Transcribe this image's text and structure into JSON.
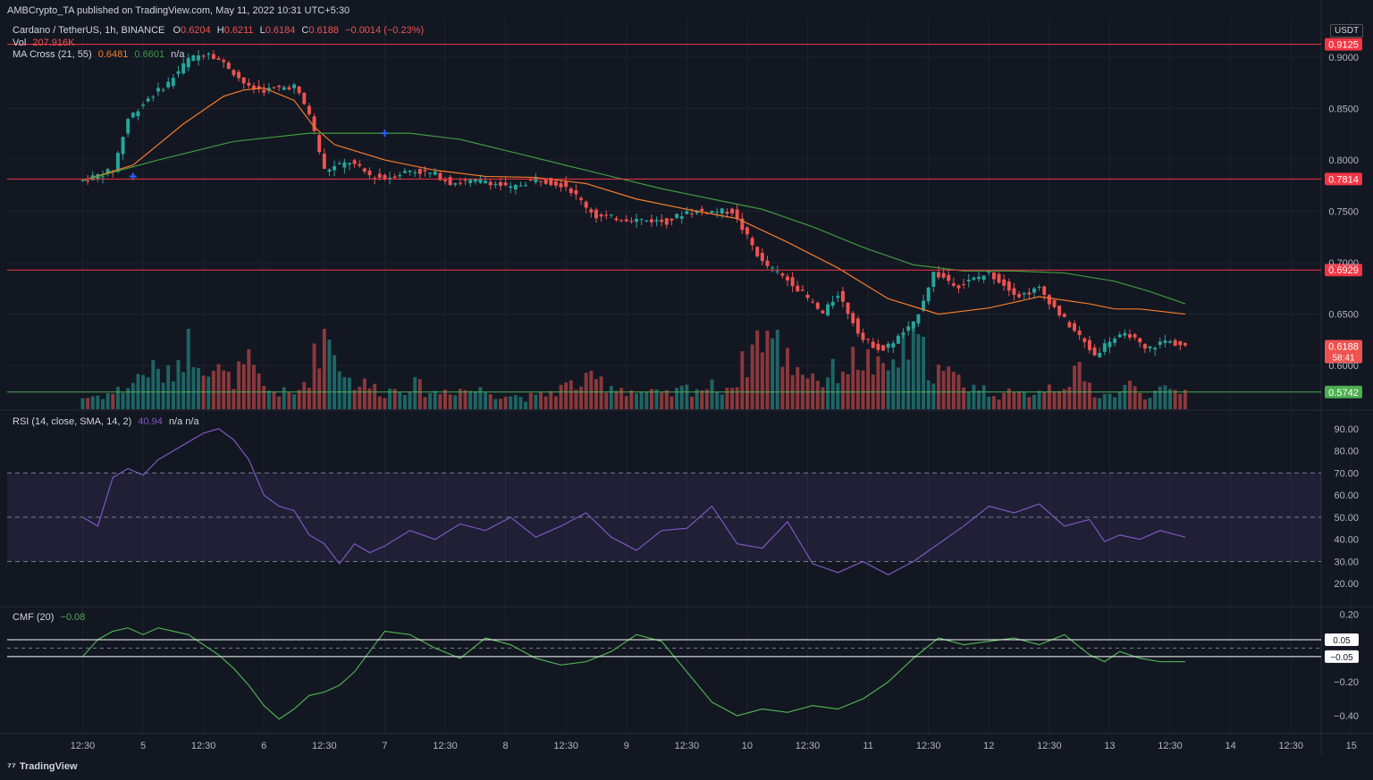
{
  "publisher": "AMBCrypto_TA published on TradingView.com, May 11, 2022 10:31 UTC+5:30",
  "symbol": {
    "name": "Cardano / TetherUS, 1h, BINANCE",
    "open_label": "O",
    "open": "0.6204",
    "high_label": "H",
    "high": "0.6211",
    "low_label": "L",
    "low": "0.6184",
    "close_label": "C",
    "close": "0.6188",
    "change": "−0.0014 (−0.23%)"
  },
  "vol": {
    "label": "Vol",
    "value": "207.916K"
  },
  "ma_cross": {
    "label": "MA Cross (21, 55)",
    "fast": "0.6481",
    "slow": "0.6601",
    "extra": "n/a"
  },
  "rsi_header": {
    "label": "RSI (14, close, SMA, 14, 2)",
    "value": "40.94",
    "extra": "n/a n/a"
  },
  "cmf_header": {
    "label": "CMF (20)",
    "value": "−0.08"
  },
  "currency": "USDT",
  "watermark": "TradingView",
  "colors": {
    "background": "#131722",
    "up": "#26a69a",
    "down": "#ef5350",
    "ma_fast": "#f57c2a",
    "ma_slow": "#3e9a3e",
    "rsi": "#7e57c2",
    "cmf": "#4caf50",
    "resistance": "#f23645",
    "support": "#4caf50",
    "marker": "#2962ff"
  },
  "price_levels": [
    {
      "value": 0.9125,
      "label": "0.9125",
      "kind": "resistance"
    },
    {
      "value": 0.7814,
      "label": "0.7814",
      "kind": "resistance"
    },
    {
      "value": 0.6929,
      "label": "0.6929",
      "kind": "resistance"
    },
    {
      "value": 0.5742,
      "label": "0.5742",
      "kind": "support"
    }
  ],
  "last_price": {
    "value": 0.6188,
    "label": "0.6188",
    "countdown": "58:41"
  },
  "cmf_levels": [
    {
      "value": 0.05,
      "label": "0.05"
    },
    {
      "value": -0.05,
      "label": "−0.05"
    }
  ],
  "chart_data": [
    {
      "type": "line",
      "pane": "price",
      "ylim": [
        0.5575,
        0.9365
      ],
      "yticks": [
        "0.9000",
        "0.8500",
        "0.8000",
        "0.7500",
        "0.7000",
        "0.6500",
        "0.6000"
      ],
      "ytick_values": [
        0.9,
        0.85,
        0.8,
        0.75,
        0.7,
        0.65,
        0.6
      ],
      "xticks": [
        "12:30",
        "5",
        "12:30",
        "6",
        "12:30",
        "7",
        "12:30",
        "8",
        "12:30",
        "9",
        "12:30",
        "10",
        "12:30",
        "11",
        "12:30",
        "12",
        "12:30",
        "13",
        "12:30",
        "14",
        "12:30",
        "15",
        "12:30"
      ],
      "xrange_hours": [
        -15,
        246
      ],
      "series": [
        {
          "name": "",
          "kind": "price",
          "x": [
            0,
            6,
            9,
            13,
            17,
            21,
            25,
            29,
            33,
            36,
            42,
            45,
            48,
            53,
            57,
            60,
            65,
            70,
            73,
            80,
            85,
            90,
            96,
            102,
            110,
            116,
            120,
            129,
            135,
            141,
            147,
            150,
            155,
            159,
            165,
            169,
            174,
            180,
            186,
            190,
            194,
            198,
            201,
            204,
            208,
            211,
            215,
            219
          ],
          "values": [
            0.78,
            0.79,
            0.84,
            0.86,
            0.875,
            0.898,
            0.905,
            0.89,
            0.87,
            0.868,
            0.872,
            0.845,
            0.79,
            0.798,
            0.785,
            0.782,
            0.79,
            0.786,
            0.778,
            0.78,
            0.772,
            0.782,
            0.775,
            0.745,
            0.742,
            0.74,
            0.75,
            0.75,
            0.7,
            0.68,
            0.65,
            0.67,
            0.625,
            0.615,
            0.64,
            0.69,
            0.678,
            0.69,
            0.668,
            0.675,
            0.65,
            0.628,
            0.61,
            0.625,
            0.63,
            0.615,
            0.624,
            0.619
          ]
        },
        {
          "name": "",
          "kind": "ma_fast",
          "x": [
            0,
            10,
            20,
            28,
            32,
            36,
            42,
            46,
            50,
            60,
            70,
            80,
            90,
            100,
            110,
            120,
            130,
            140,
            150,
            160,
            170,
            180,
            190,
            200,
            205,
            210,
            219
          ],
          "values": [
            0.78,
            0.795,
            0.835,
            0.862,
            0.868,
            0.87,
            0.858,
            0.832,
            0.815,
            0.8,
            0.79,
            0.784,
            0.783,
            0.777,
            0.762,
            0.752,
            0.743,
            0.72,
            0.695,
            0.665,
            0.65,
            0.656,
            0.667,
            0.66,
            0.655,
            0.655,
            0.65
          ]
        },
        {
          "name": "",
          "kind": "ma_slow",
          "x": [
            0,
            15,
            30,
            45,
            55,
            65,
            75,
            85,
            95,
            105,
            115,
            125,
            135,
            145,
            155,
            165,
            175,
            185,
            195,
            205,
            212,
            219
          ],
          "values": [
            0.78,
            0.8,
            0.818,
            0.826,
            0.826,
            0.826,
            0.82,
            0.808,
            0.796,
            0.784,
            0.772,
            0.762,
            0.752,
            0.735,
            0.715,
            0.698,
            0.692,
            0.692,
            0.69,
            0.682,
            0.672,
            0.66
          ]
        }
      ],
      "markers": [
        {
          "x": 10,
          "y": 0.784
        },
        {
          "x": 60,
          "y": 0.826
        }
      ]
    },
    {
      "type": "bar",
      "pane": "volume",
      "x": [
        0,
        6,
        9,
        13,
        17,
        21,
        25,
        29,
        33,
        36,
        42,
        45,
        48,
        53,
        57,
        60,
        65,
        70,
        73,
        80,
        85,
        90,
        96,
        102,
        110,
        116,
        120,
        129,
        135,
        141,
        147,
        150,
        155,
        159,
        165,
        169,
        174,
        180,
        186,
        190,
        194,
        198,
        201,
        204,
        208,
        211,
        215,
        219
      ],
      "values": [
        10,
        14,
        20,
        35,
        28,
        60,
        40,
        25,
        38,
        18,
        12,
        30,
        70,
        25,
        20,
        15,
        22,
        14,
        18,
        16,
        12,
        10,
        20,
        25,
        15,
        12,
        18,
        20,
        70,
        40,
        25,
        35,
        45,
        30,
        60,
        35,
        25,
        15,
        12,
        18,
        22,
        30,
        15,
        12,
        20,
        14,
        15,
        16
      ]
    },
    {
      "type": "line",
      "pane": "rsi",
      "ylim": [
        10,
        98
      ],
      "yticks": [
        "90.00",
        "80.00",
        "70.00",
        "60.00",
        "50.00",
        "40.00",
        "30.00",
        "20.00"
      ],
      "ytick_values": [
        90,
        80,
        70,
        60,
        50,
        40,
        30,
        20
      ],
      "bands": [
        30,
        50,
        70
      ],
      "series": [
        {
          "name": "",
          "x": [
            0,
            3,
            6,
            9,
            12,
            15,
            18,
            21,
            24,
            27,
            30,
            33,
            36,
            39,
            42,
            45,
            48,
            51,
            54,
            57,
            60,
            65,
            70,
            75,
            80,
            85,
            90,
            95,
            100,
            105,
            110,
            115,
            120,
            125,
            130,
            135,
            140,
            145,
            150,
            155,
            160,
            165,
            170,
            175,
            180,
            185,
            190,
            195,
            200,
            203,
            206,
            210,
            214,
            219
          ],
          "values": [
            50,
            46,
            68,
            72,
            69,
            76,
            80,
            84,
            88,
            90,
            85,
            76,
            60,
            55,
            53,
            42,
            38,
            29,
            38,
            34,
            37,
            44,
            40,
            47,
            44,
            50,
            41,
            46,
            52,
            41,
            35,
            44,
            45,
            55,
            38,
            36,
            48,
            29,
            25,
            30,
            24,
            30,
            38,
            46,
            55,
            52,
            56,
            46,
            49,
            39,
            42,
            40,
            44,
            41
          ]
        }
      ]
    },
    {
      "type": "line",
      "pane": "cmf",
      "ylim": [
        -0.5,
        0.24
      ],
      "yticks": [
        "0.20",
        "−0.20",
        "−0.40"
      ],
      "ytick_values": [
        0.2,
        -0.2,
        -0.4
      ],
      "zero_line": 0,
      "series": [
        {
          "name": "",
          "x": [
            0,
            3,
            6,
            9,
            12,
            15,
            18,
            21,
            24,
            27,
            30,
            33,
            36,
            39,
            42,
            45,
            48,
            51,
            54,
            57,
            60,
            65,
            70,
            75,
            80,
            85,
            90,
            95,
            100,
            105,
            110,
            115,
            120,
            125,
            130,
            135,
            140,
            145,
            150,
            155,
            160,
            165,
            170,
            175,
            180,
            185,
            190,
            195,
            200,
            203,
            206,
            210,
            214,
            219
          ],
          "values": [
            -0.05,
            0.05,
            0.1,
            0.12,
            0.08,
            0.12,
            0.1,
            0.08,
            0.02,
            -0.04,
            -0.12,
            -0.22,
            -0.34,
            -0.42,
            -0.36,
            -0.28,
            -0.26,
            -0.22,
            -0.14,
            -0.02,
            0.1,
            0.08,
            0.0,
            -0.06,
            0.06,
            0.02,
            -0.06,
            -0.1,
            -0.08,
            -0.02,
            0.08,
            0.04,
            -0.14,
            -0.32,
            -0.4,
            -0.36,
            -0.38,
            -0.34,
            -0.36,
            -0.3,
            -0.2,
            -0.06,
            0.06,
            0.02,
            0.04,
            0.06,
            0.02,
            0.08,
            -0.04,
            -0.08,
            -0.02,
            -0.06,
            -0.08,
            -0.08
          ]
        }
      ]
    }
  ]
}
